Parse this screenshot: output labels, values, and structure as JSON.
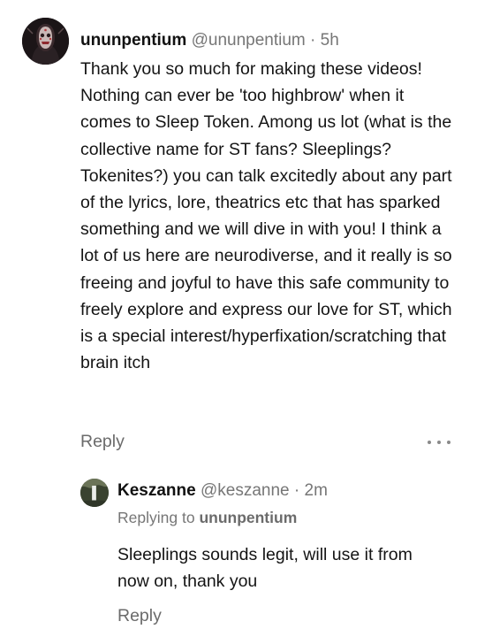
{
  "comment": {
    "author": "ununpentium",
    "handle": "@ununpentium",
    "separator": "·",
    "time": "5h",
    "body": "Thank you so much for making these videos! Nothing can ever be 'too highbrow' when it comes to Sleep Token. Among us lot (what is the collective name for ST fans? Sleeplings? Tokenites?) you can talk excitedly about any part of the lyrics, lore, theatrics etc that has sparked something and we will dive in with you! I think a lot of us here are neurodiverse, and it really is so freeing and joyful to have this safe community to freely explore and express our love for ST, which is a special interest/hyperfixation/scratching that brain itch",
    "reply_label": "Reply",
    "more_icon": "more-horizontal-icon"
  },
  "reply": {
    "author": "Keszanne",
    "handle": "@keszanne",
    "separator": "·",
    "time": "2m",
    "replying_prefix": "Replying to",
    "replying_target": "ununpentium",
    "body": "Sleeplings sounds legit, will use it from now on, thank you",
    "reply_label": "Reply"
  },
  "colors": {
    "text": "#141414",
    "muted": "#767676",
    "background": "#ffffff"
  }
}
